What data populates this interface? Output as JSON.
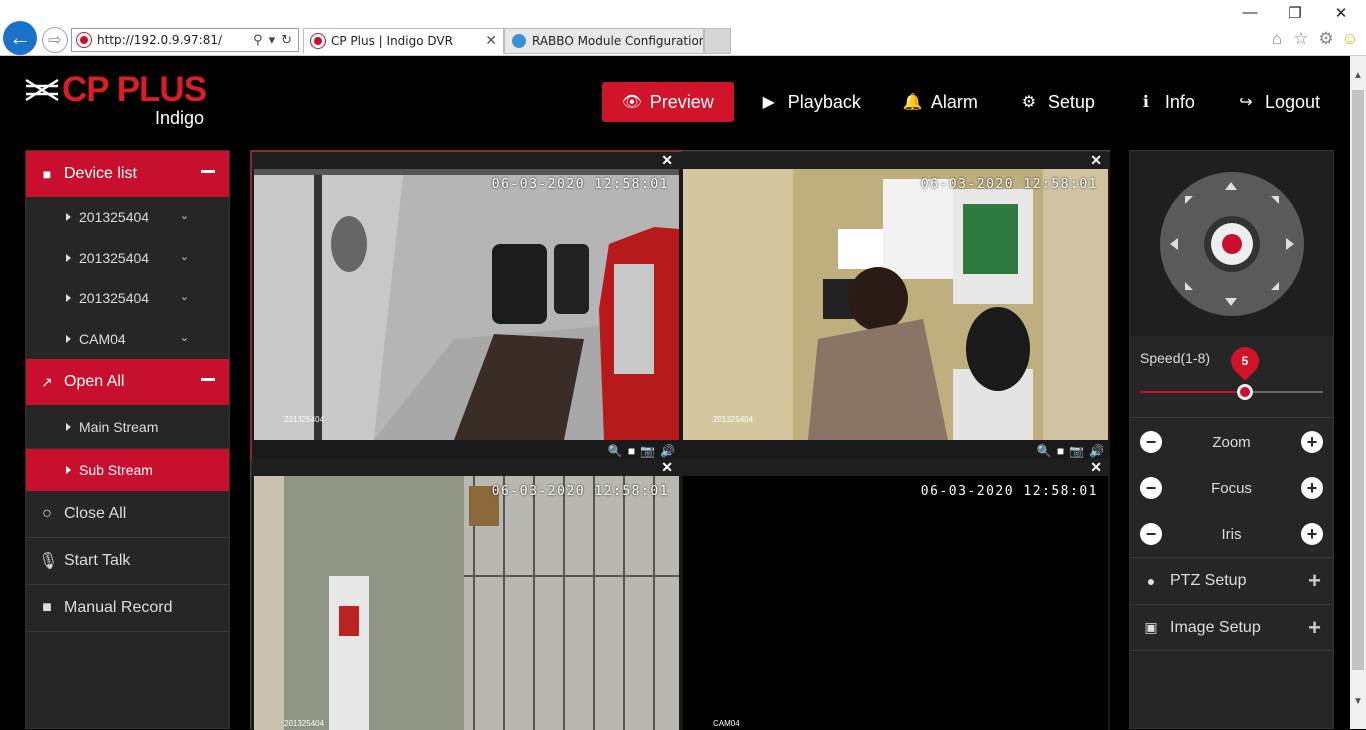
{
  "browser": {
    "url": "http://192.0.9.97:81/",
    "tabs": [
      {
        "title": "CP Plus | Indigo DVR",
        "active": true
      },
      {
        "title": "RABBO Module Configuration",
        "active": false
      }
    ],
    "icons": [
      "back-arrow-icon",
      "forward-arrow-icon",
      "search-icon",
      "refresh-icon",
      "home-icon",
      "star-icon",
      "gear-icon",
      "smiley-icon"
    ]
  },
  "logo": {
    "brand": "CP PLUS",
    "sub": "Indigo"
  },
  "nav": [
    {
      "label": "Preview",
      "icon": "eye-icon",
      "active": true
    },
    {
      "label": "Playback",
      "icon": "play-circle-icon",
      "active": false
    },
    {
      "label": "Alarm",
      "icon": "bell-icon",
      "active": false
    },
    {
      "label": "Setup",
      "icon": "gear-icon",
      "active": false
    },
    {
      "label": "Info",
      "icon": "info-icon",
      "active": false
    },
    {
      "label": "Logout",
      "icon": "logout-icon",
      "active": false
    }
  ],
  "sidebar": {
    "device_list": {
      "title": "Device list",
      "items": [
        "201325404",
        "201325404",
        "201325404",
        "CAM04"
      ]
    },
    "open_all": {
      "title": "Open All",
      "streams": [
        {
          "label": "Main Stream",
          "selected": false
        },
        {
          "label": "Sub Stream",
          "selected": true
        }
      ]
    },
    "actions": [
      {
        "label": "Close All",
        "icon": "circle-icon"
      },
      {
        "label": "Start Talk",
        "icon": "microphone-icon"
      },
      {
        "label": "Manual Record",
        "icon": "video-camera-icon"
      }
    ]
  },
  "cameras": [
    {
      "timestamp": "06-03-2020 12:58:01",
      "cam_id": "201325404",
      "focused": true
    },
    {
      "timestamp": "06-03-2020 12:58:01",
      "cam_id": "201325404",
      "focused": false
    },
    {
      "timestamp": "06-03-2020 12:58:01",
      "cam_id": "201325404",
      "focused": false
    },
    {
      "timestamp": "06-03-2020 12:58:01",
      "cam_id": "CAM04",
      "focused": false
    }
  ],
  "ptz": {
    "speed_label": "Speed(1-8)",
    "speed_value": "5",
    "speed_min": 1,
    "speed_max": 8,
    "controls": [
      "Zoom",
      "Focus",
      "Iris"
    ],
    "setups": [
      {
        "label": "PTZ Setup",
        "icon": "gamepad-icon"
      },
      {
        "label": "Image Setup",
        "icon": "image-icon"
      }
    ]
  },
  "colors": {
    "accent": "#c8102e",
    "panel": "#262626",
    "background": "#000000"
  }
}
